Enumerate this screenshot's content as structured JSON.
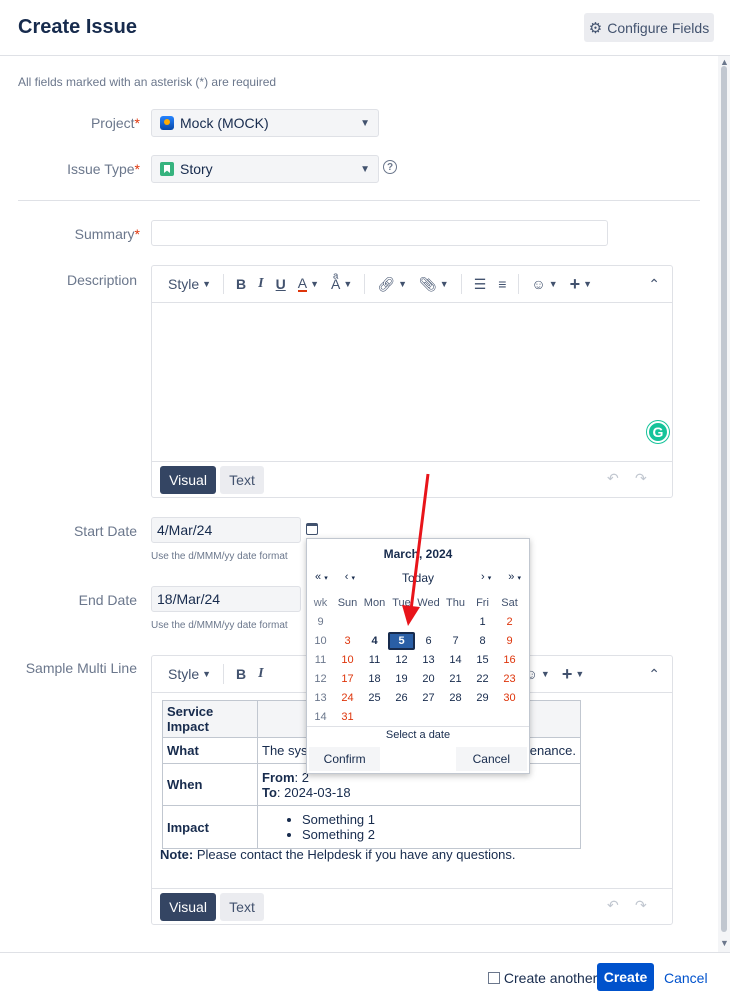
{
  "dialog": {
    "title": "Create Issue",
    "configure_fields": "Configure Fields",
    "required_note": "All fields marked with an asterisk (*) are required"
  },
  "fields": {
    "project": {
      "label": "Project",
      "value": "Mock (MOCK)"
    },
    "issue_type": {
      "label": "Issue Type",
      "value": "Story"
    },
    "summary": {
      "label": "Summary",
      "value": ""
    },
    "description": {
      "label": "Description"
    },
    "start_date": {
      "label": "Start Date",
      "value": "4/Mar/24",
      "hint": "Use the d/MMM/yy date format"
    },
    "end_date": {
      "label": "End Date",
      "value": "18/Mar/24",
      "hint": "Use the d/MMM/yy date format"
    },
    "sample_multi_line": {
      "label": "Sample Multi Line"
    }
  },
  "asterisk": "*",
  "editor": {
    "style_label": "Style",
    "bold": "B",
    "italic": "I",
    "underline": "U",
    "text_color": "A",
    "visual_label": "Visual",
    "text_label": "Text"
  },
  "service_table": {
    "header": "Service Impact",
    "rows": {
      "what_label": "What",
      "what_value": "The sys",
      "what_value_end": "tenance.",
      "when_label": "When",
      "from_label": "From",
      "from_value": ": 2",
      "to_label": "To",
      "to_value": ": 2024-03-18",
      "impact_label": "Impact",
      "impact_items": [
        "Something 1",
        "Something 2"
      ]
    },
    "note_label": "Note:",
    "note_text": " Please contact the Helpdesk if you have any questions."
  },
  "calendar": {
    "title": "March, 2024",
    "nav_prev_year": "«",
    "nav_prev_month": "‹",
    "nav_today": "Today",
    "nav_next_month": "›",
    "nav_next_year": "»",
    "nav_menu": "▾",
    "headers": [
      "wk",
      "Sun",
      "Mon",
      "Tue",
      "Wed",
      "Thu",
      "Fri",
      "Sat"
    ],
    "weeks": [
      [
        "9",
        "",
        "",
        "",
        "",
        "",
        "1",
        "2"
      ],
      [
        "10",
        "3",
        "4",
        "5",
        "6",
        "7",
        "8",
        "9"
      ],
      [
        "11",
        "10",
        "11",
        "12",
        "13",
        "14",
        "15",
        "16"
      ],
      [
        "12",
        "17",
        "18",
        "19",
        "20",
        "21",
        "22",
        "23"
      ],
      [
        "13",
        "24",
        "25",
        "26",
        "27",
        "28",
        "29",
        "30"
      ],
      [
        "14",
        "31",
        "",
        "",
        "",
        "",
        "",
        ""
      ]
    ],
    "today_day": "4",
    "selected_day": "5",
    "status": "Select a date",
    "confirm": "Confirm",
    "cancel": "Cancel"
  },
  "footer": {
    "create_another": "Create another",
    "create": "Create",
    "cancel": "Cancel"
  },
  "colors": {
    "primary": "#0052cc",
    "required": "#de350b",
    "arrow": "#e8141a"
  }
}
